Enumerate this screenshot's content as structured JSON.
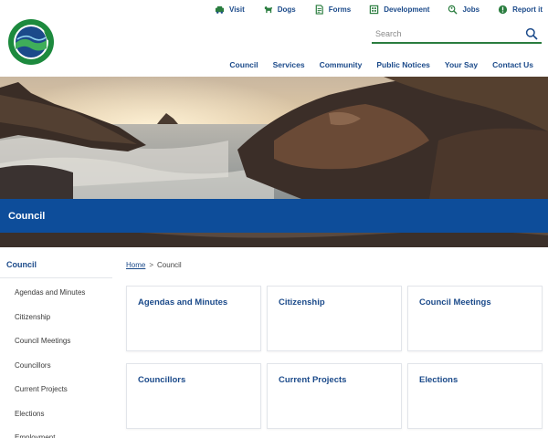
{
  "utility_links": [
    {
      "label": "Visit",
      "icon": "car-icon"
    },
    {
      "label": "Dogs",
      "icon": "dog-icon"
    },
    {
      "label": "Forms",
      "icon": "form-icon"
    },
    {
      "label": "Development",
      "icon": "building-icon"
    },
    {
      "label": "Jobs",
      "icon": "magnifier-person-icon"
    },
    {
      "label": "Report it",
      "icon": "report-icon"
    }
  ],
  "search": {
    "placeholder": "Search"
  },
  "main_nav": [
    "Council",
    "Services",
    "Community",
    "Public Notices",
    "Your Say",
    "Contact Us"
  ],
  "hero": {
    "title": "Council"
  },
  "sidebar": {
    "title": "Council",
    "items": [
      "Agendas and Minutes",
      "Citizenship",
      "Council Meetings",
      "Councillors",
      "Current Projects",
      "Elections",
      "Employment"
    ]
  },
  "breadcrumb": {
    "home": "Home",
    "separator": ">",
    "current": "Council"
  },
  "cards": [
    "Agendas and Minutes",
    "Citizenship",
    "Council Meetings",
    "Councillors",
    "Current Projects",
    "Elections"
  ],
  "colors": {
    "brand_blue": "#0d4d9a",
    "link_blue": "#1b4a8a",
    "accent_green": "#2a7d3f"
  }
}
